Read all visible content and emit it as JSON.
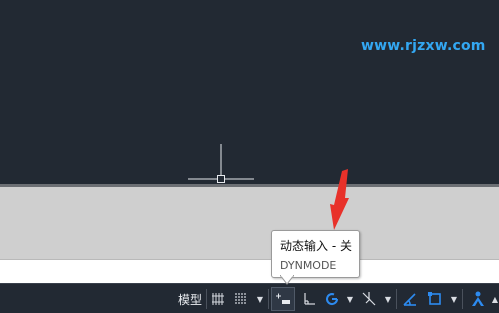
{
  "watermark": "www.rjzxw.com",
  "tooltip": {
    "title": "动态输入 - 关",
    "subtitle": "DYNMODE"
  },
  "statusbar": {
    "model_label": "模型",
    "icons": [
      "grid-icon",
      "snap-icon",
      "dynamic-input-icon",
      "ortho-icon",
      "polar-tracking-icon",
      "isodraft-icon",
      "object-snap-tracking-icon",
      "object-snap-icon",
      "annotation-scale-icon"
    ]
  },
  "colors": {
    "canvas": "#222933",
    "watermark": "#33a7f2",
    "arrow": "#e8312a",
    "command_area": "#cfcfcf",
    "accent_blue": "#2d8bf0"
  }
}
